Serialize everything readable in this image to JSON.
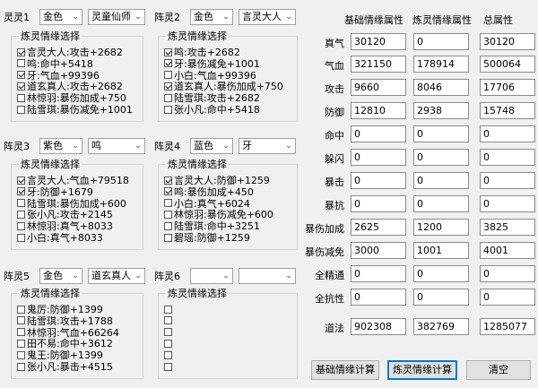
{
  "slots": [
    {
      "label": "灵灵1",
      "grade": "金色",
      "name": "灵童仙师",
      "group_title": "炼灵情缘选择",
      "items": [
        {
          "text": "言灵大人:攻击+2682",
          "checked": true
        },
        {
          "text": "鸣:命中+5418",
          "checked": false
        },
        {
          "text": "牙:气血+99396",
          "checked": true
        },
        {
          "text": "道玄真人:攻击+2682",
          "checked": true
        },
        {
          "text": "林惊羽:暴伤加成+750",
          "checked": false
        },
        {
          "text": "陆雪琪:暴伤减免+1001",
          "checked": false
        }
      ]
    },
    {
      "label": "阵灵2",
      "grade": "金色",
      "name": "言灵大人",
      "group_title": "炼灵情缘选择",
      "items": [
        {
          "text": "鸣:攻击+2682",
          "checked": true
        },
        {
          "text": "牙:暴伤减免+1001",
          "checked": true
        },
        {
          "text": "小白:气血+99396",
          "checked": false
        },
        {
          "text": "道玄真人:暴伤加成+750",
          "checked": true
        },
        {
          "text": "陆雪琪:攻击+2682",
          "checked": false
        },
        {
          "text": "张小凡:命中+5418",
          "checked": false
        }
      ]
    },
    {
      "label": "阵灵3",
      "grade": "紫色",
      "name": "鸣",
      "group_title": "炼灵情缘选择",
      "items": [
        {
          "text": "言灵大人:气血+79518",
          "checked": true
        },
        {
          "text": "牙:防御+1679",
          "checked": true
        },
        {
          "text": "陆雪琪:暴伤加成+600",
          "checked": false
        },
        {
          "text": "张小凡:攻击+2145",
          "checked": false
        },
        {
          "text": "林惊羽:真气+8033",
          "checked": false
        },
        {
          "text": "小白:真气+8033",
          "checked": false
        }
      ]
    },
    {
      "label": "阵灵4",
      "grade": "蓝色",
      "name": "牙",
      "group_title": "炼灵情缘选择",
      "items": [
        {
          "text": "言灵大人:防御+1259",
          "checked": true
        },
        {
          "text": "鸣:暴伤加成+450",
          "checked": true
        },
        {
          "text": "小白:真气+6024",
          "checked": false
        },
        {
          "text": "林惊羽:暴伤减免+600",
          "checked": false
        },
        {
          "text": "陆雪琪:命中+3251",
          "checked": false
        },
        {
          "text": "碧瑶:防御+1259",
          "checked": false
        }
      ]
    },
    {
      "label": "阵灵5",
      "grade": "金色",
      "name": "道玄真人",
      "group_title": "炼灵情缘选择",
      "items": [
        {
          "text": "鬼厉:防御+1399",
          "checked": false
        },
        {
          "text": "陆雪琪:攻击+1788",
          "checked": false
        },
        {
          "text": "林惊羽:气血+66264",
          "checked": false
        },
        {
          "text": "田不易:命中+3612",
          "checked": false
        },
        {
          "text": "鬼王:防御+1399",
          "checked": false
        },
        {
          "text": "张小凡:暴击+4515",
          "checked": false
        }
      ]
    },
    {
      "label": "阵灵6",
      "grade": "",
      "name": "",
      "group_title": "炼灵情缘选择",
      "items": [
        {
          "text": "",
          "checked": false
        },
        {
          "text": "",
          "checked": false
        },
        {
          "text": "",
          "checked": false
        },
        {
          "text": "",
          "checked": false
        },
        {
          "text": "",
          "checked": false
        },
        {
          "text": "",
          "checked": false
        }
      ]
    }
  ],
  "stats": {
    "headers": [
      "基础情缘属性",
      "炼灵情缘属性",
      "总属性"
    ],
    "rows": [
      {
        "label": "真气",
        "base": "30120",
        "lianling": "0",
        "total": "30120"
      },
      {
        "label": "气血",
        "base": "321150",
        "lianling": "178914",
        "total": "500064"
      },
      {
        "label": "攻击",
        "base": "9660",
        "lianling": "8046",
        "total": "17706"
      },
      {
        "label": "防御",
        "base": "12810",
        "lianling": "2938",
        "total": "15748"
      },
      {
        "label": "命中",
        "base": "0",
        "lianling": "0",
        "total": "0"
      },
      {
        "label": "躲闪",
        "base": "0",
        "lianling": "0",
        "total": "0"
      },
      {
        "label": "暴击",
        "base": "0",
        "lianling": "0",
        "total": "0"
      },
      {
        "label": "暴抗",
        "base": "0",
        "lianling": "0",
        "total": "0"
      },
      {
        "label": "暴伤加成",
        "base": "2625",
        "lianling": "1200",
        "total": "3825"
      },
      {
        "label": "暴伤减免",
        "base": "3000",
        "lianling": "1001",
        "total": "4001"
      },
      {
        "label": "全精通",
        "base": "0",
        "lianling": "0",
        "total": "0"
      },
      {
        "label": "全抗性",
        "base": "0",
        "lianling": "0",
        "total": "0"
      },
      {
        "label": "道法",
        "base": "902308",
        "lianling": "382769",
        "total": "1285077"
      }
    ]
  },
  "buttons": {
    "base_calc": "基础情缘计算",
    "lianling_calc": "炼灵情缘计算",
    "clear": "清空"
  },
  "icons": {
    "dropdown": "chevron-down-icon"
  }
}
